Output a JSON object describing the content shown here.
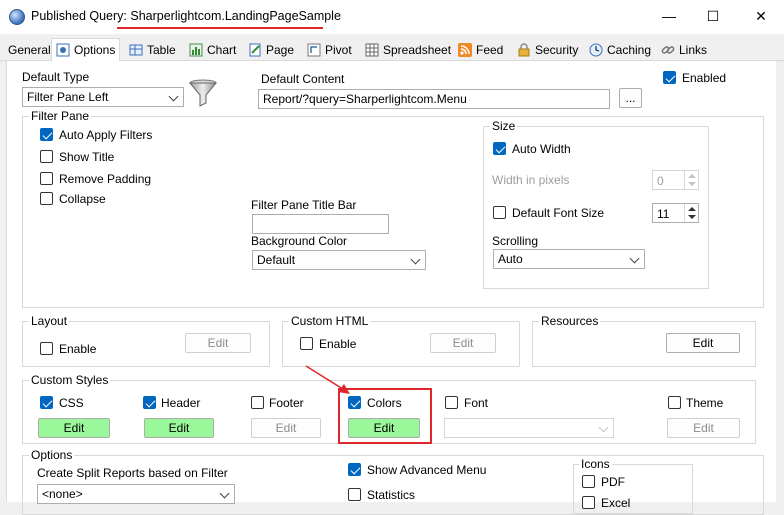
{
  "window": {
    "title_prefix": "Published Query: ",
    "title_name": "Sharperlightcom.LandingPageSample",
    "minimize": "—",
    "maximize": "☐",
    "close": "✕"
  },
  "tabs": [
    {
      "label": "General",
      "icon": "none"
    },
    {
      "label": "Options",
      "icon": "options-icon"
    },
    {
      "label": "Table",
      "icon": "table-icon"
    },
    {
      "label": "Chart",
      "icon": "chart-icon"
    },
    {
      "label": "Page",
      "icon": "page-icon"
    },
    {
      "label": "Pivot",
      "icon": "pivot-icon"
    },
    {
      "label": "Spreadsheet",
      "icon": "spreadsheet-icon"
    },
    {
      "label": "Feed",
      "icon": "rss-icon"
    },
    {
      "label": "Security",
      "icon": "lock-icon"
    },
    {
      "label": "Caching",
      "icon": "clock-icon"
    },
    {
      "label": "Links",
      "icon": "link-icon"
    }
  ],
  "default_type": {
    "label": "Default Type",
    "value": "Filter Pane Left"
  },
  "default_content": {
    "label": "Default Content",
    "value": "Report/?query=Sharperlightcom.Menu",
    "browse": "..."
  },
  "enabled": {
    "label": "Enabled",
    "checked": true
  },
  "filter_pane": {
    "title": "Filter Pane",
    "auto_apply": {
      "label": "Auto Apply Filters",
      "checked": true
    },
    "show_title": {
      "label": "Show Title",
      "checked": false
    },
    "remove_padding": {
      "label": "Remove Padding",
      "checked": false
    },
    "collapse": {
      "label": "Collapse",
      "checked": false
    },
    "title_bar_label": "Filter Pane Title Bar",
    "title_bar_value": "",
    "bg_color_label": "Background Color",
    "bg_color_value": "Default"
  },
  "size": {
    "title": "Size",
    "auto_width": {
      "label": "Auto Width",
      "checked": true
    },
    "width_label": "Width in pixels",
    "width_value": "0",
    "default_font": {
      "label": "Default Font Size",
      "checked": false
    },
    "font_size_value": "11",
    "scrolling_label": "Scrolling",
    "scrolling_value": "Auto"
  },
  "layout": {
    "title": "Layout",
    "enable_label": "Enable",
    "checked": false,
    "edit": "Edit"
  },
  "custom_html": {
    "title": "Custom HTML",
    "enable_label": "Enable",
    "checked": false,
    "edit": "Edit"
  },
  "resources": {
    "title": "Resources",
    "edit": "Edit"
  },
  "custom_styles": {
    "title": "Custom Styles",
    "css": {
      "label": "CSS",
      "checked": true,
      "edit": "Edit"
    },
    "header": {
      "label": "Header",
      "checked": true,
      "edit": "Edit"
    },
    "footer": {
      "label": "Footer",
      "checked": false,
      "edit": "Edit"
    },
    "colors": {
      "label": "Colors",
      "checked": true,
      "edit": "Edit"
    },
    "font": {
      "label": "Font",
      "checked": false,
      "value": ""
    },
    "theme": {
      "label": "Theme",
      "checked": false,
      "edit": "Edit"
    }
  },
  "options": {
    "title": "Options",
    "split_label": "Create Split Reports based on Filter",
    "split_value": "<none>",
    "show_advanced_menu": {
      "label": "Show Advanced Menu",
      "checked": true
    },
    "statistics": {
      "label": "Statistics",
      "checked": false
    }
  },
  "icons_group": {
    "title": "Icons",
    "pdf": {
      "label": "PDF",
      "checked": false
    },
    "excel": {
      "label": "Excel",
      "checked": false
    }
  },
  "colors": {
    "accent": "#0067c0",
    "highlight": "#e0262a",
    "green_button": "#9af79a"
  }
}
